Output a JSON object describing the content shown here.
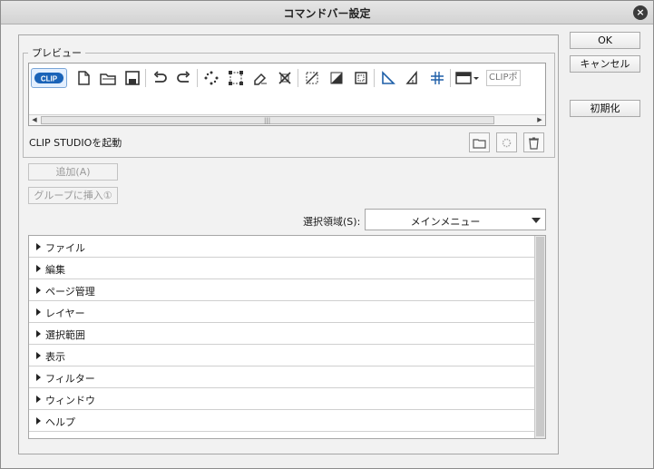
{
  "window": {
    "title": "コマンドバー設定"
  },
  "preview": {
    "legend": "プレビュー",
    "logo_text": "CLIP",
    "overflow_label": "CLIPポ",
    "command_name": "CLIP STUDIOを起動",
    "toolbar_icons": [
      "clip-studio-logo-icon",
      "new-file-icon",
      "open-folder-icon",
      "save-icon",
      "undo-icon",
      "redo-icon",
      "selection-dots-icon",
      "transform-icon",
      "eraser-selection-icon",
      "crop-icon",
      "deselect-icon",
      "fill-icon",
      "border-icon",
      "ruler-icon",
      "ruler-corner-icon",
      "grid-icon",
      "menu-dropdown-icon"
    ]
  },
  "buttons": {
    "ok": "OK",
    "cancel": "キャンセル",
    "reset": "初期化",
    "add": "追加(A)",
    "insert_group": "グループに挿入①"
  },
  "area": {
    "label": "選択領域(S):",
    "selected": "メインメニュー"
  },
  "tree": {
    "items": [
      {
        "label": "ファイル"
      },
      {
        "label": "編集"
      },
      {
        "label": "ページ管理"
      },
      {
        "label": "レイヤー"
      },
      {
        "label": "選択範囲"
      },
      {
        "label": "表示"
      },
      {
        "label": "フィルター"
      },
      {
        "label": "ウィンドウ"
      },
      {
        "label": "ヘルプ"
      }
    ]
  }
}
